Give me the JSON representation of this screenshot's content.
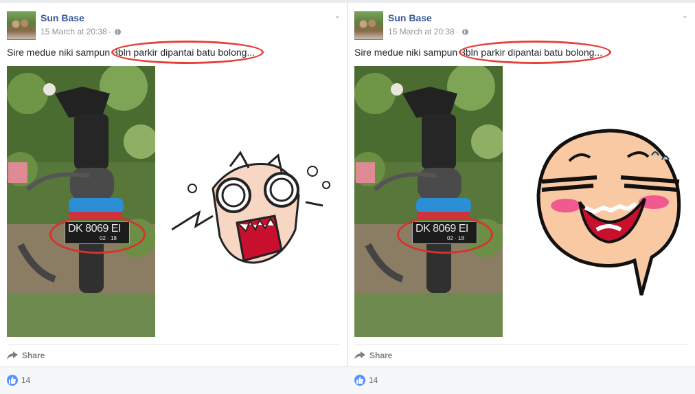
{
  "posts": [
    {
      "author": "Sun Base",
      "timestamp": "15 March at 20:38",
      "privacy_icon": "globe-icon",
      "text": "Sire medue niki sampun 3bln parkir dipantai batu bolong...",
      "plate": {
        "number": "DK 8069 EI",
        "expiry": "02 · 18"
      },
      "sticker": "shocked-face-sticker",
      "share_label": "Share",
      "like_count": "14"
    },
    {
      "author": "Sun Base",
      "timestamp": "15 March at 20:38",
      "privacy_icon": "globe-icon",
      "text": "Sire medue niki sampun 3bln parkir dipantai batu bolong...",
      "plate": {
        "number": "DK 8069 EI",
        "expiry": "02 · 18"
      },
      "sticker": "laughing-face-sticker",
      "share_label": "Share",
      "like_count": "14"
    }
  ],
  "colors": {
    "author": "#365899",
    "highlight": "#e5413b",
    "like": "#5890ff"
  }
}
